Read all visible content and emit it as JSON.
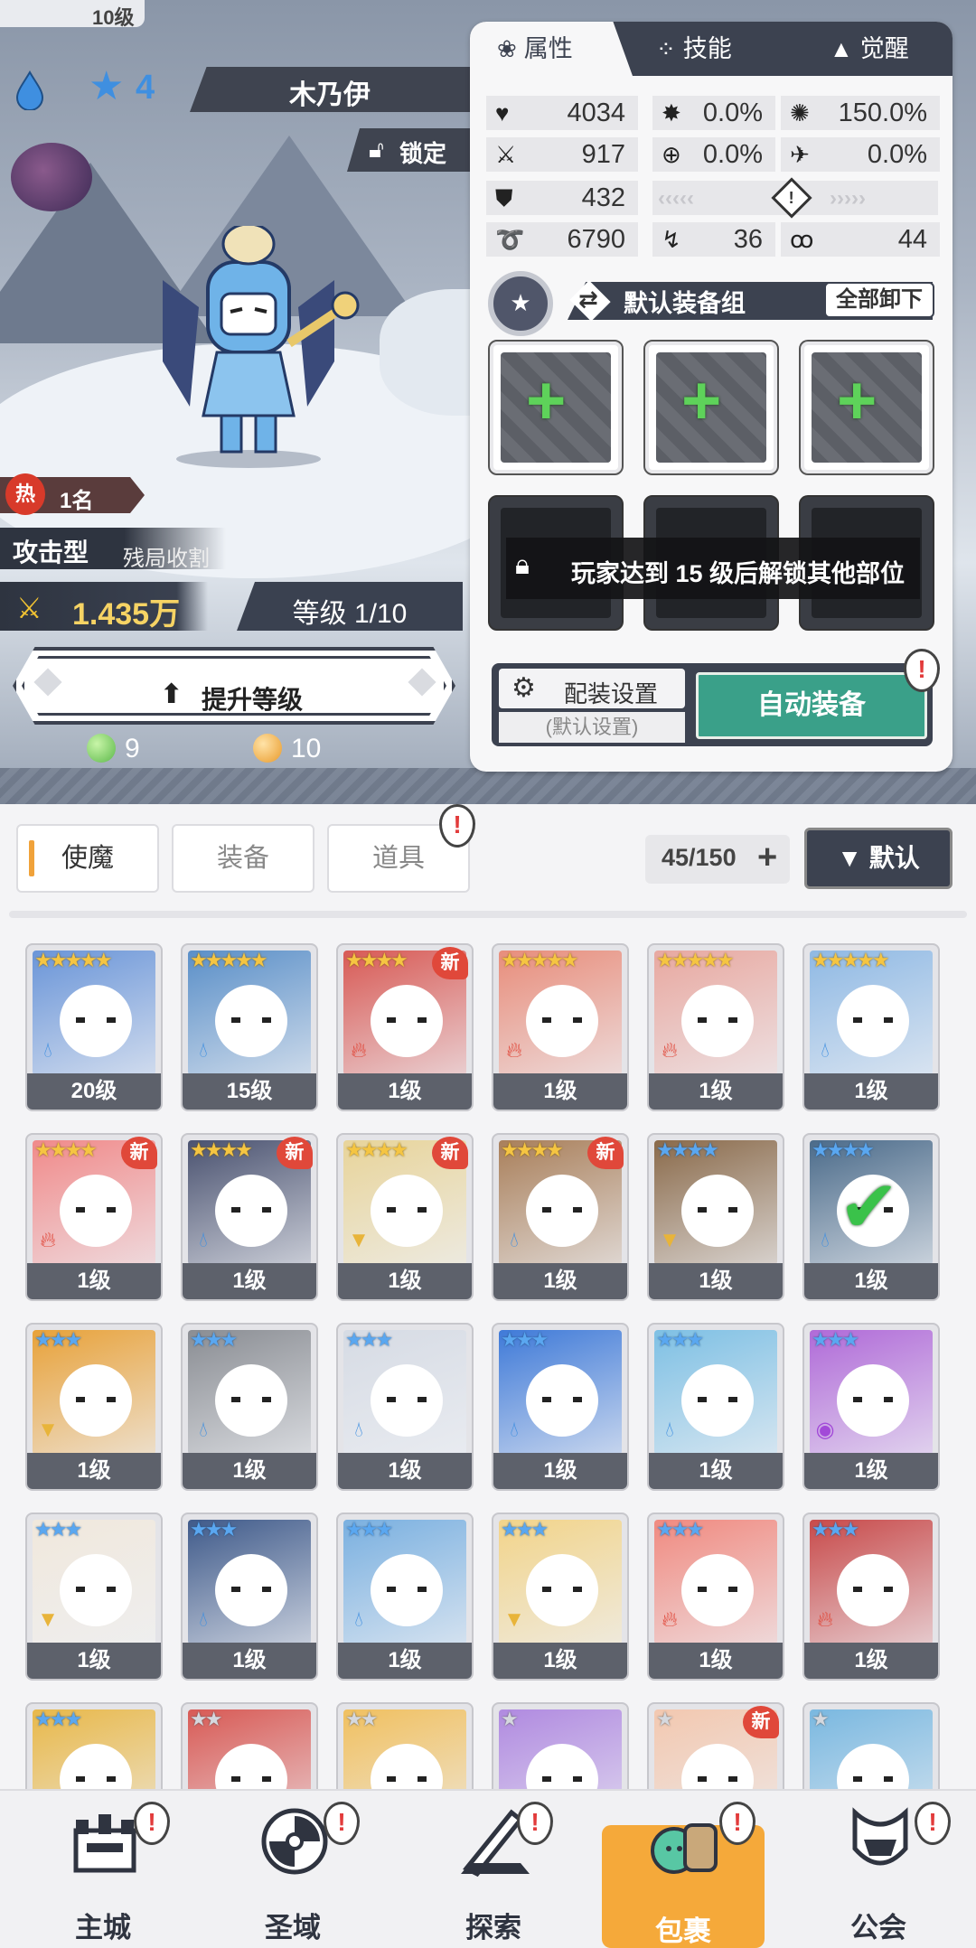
{
  "hero": {
    "level_tag": "10级",
    "star_level": "4",
    "name": "木乃伊",
    "lock_label": "锁定",
    "hot_badge": "热",
    "hot_rank": "1名",
    "type_main": "攻击型",
    "type_sub": "残局收割",
    "power": "1.435万",
    "grade": "等级 1/10",
    "upgrade_label": "提升等级",
    "cost_green": "9",
    "cost_gold": "10"
  },
  "panel": {
    "tabs": [
      {
        "label": "属性",
        "icon": "paw-icon"
      },
      {
        "label": "技能",
        "icon": "sparkle-icon"
      },
      {
        "label": "觉醒",
        "icon": "triangle-icon"
      }
    ],
    "stats": {
      "hp": "4034",
      "crit": "0.0%",
      "crit_damage": "150.0%",
      "attack": "917",
      "accuracy": "0.0%",
      "dodge": "0.0%",
      "defense": "432",
      "speed": "6790",
      "stat_a": "36",
      "stat_b": "44"
    },
    "equip_group_title": "默认装备组",
    "unequip_all": "全部卸下",
    "lock_message": "玩家达到 15 级后解锁其他部位",
    "config_label": "配装设置",
    "config_sub": "(默认设置)",
    "auto_equip": "自动装备",
    "alert_mark": "!"
  },
  "inventory": {
    "tabs": [
      "使魔",
      "装备",
      "道具"
    ],
    "active_tab": "使魔",
    "count": "45/150",
    "sort_label": "▼ 默认",
    "new_label": "新",
    "cards": [
      {
        "level": "20级",
        "stars": "★★★★★",
        "rarity": "gold",
        "elem": "water",
        "color": "#6a95d8",
        "new": false
      },
      {
        "level": "15级",
        "stars": "★★★★★",
        "rarity": "gold",
        "elem": "water",
        "color": "#5a8fc8",
        "new": false
      },
      {
        "level": "1级",
        "stars": "★★★★",
        "rarity": "gold",
        "elem": "fire",
        "color": "#d85a55",
        "new": true
      },
      {
        "level": "1级",
        "stars": "★★★★★",
        "rarity": "gold",
        "elem": "fire",
        "color": "#e88d7b",
        "new": false
      },
      {
        "level": "1级",
        "stars": "★★★★★",
        "rarity": "gold",
        "elem": "fire",
        "color": "#e8a8a0",
        "new": false
      },
      {
        "level": "1级",
        "stars": "★★★★★",
        "rarity": "gold",
        "elem": "water",
        "color": "#8fb9e4",
        "new": false
      },
      {
        "level": "1级",
        "stars": "★★★★",
        "rarity": "gold",
        "elem": "fire",
        "color": "#f08a8a",
        "new": true
      },
      {
        "level": "1级",
        "stars": "★★★★",
        "rarity": "gold",
        "elem": "water",
        "color": "#4a5270",
        "new": true
      },
      {
        "level": "1级",
        "stars": "★★★★",
        "rarity": "gold",
        "elem": "earth",
        "color": "#e8d49a",
        "new": true
      },
      {
        "level": "1级",
        "stars": "★★★★",
        "rarity": "gold",
        "elem": "water",
        "color": "#a97f5a",
        "new": true
      },
      {
        "level": "1级",
        "stars": "★★★★",
        "rarity": "blue",
        "elem": "earth",
        "color": "#8a6a4a",
        "new": false
      },
      {
        "level": "1级",
        "stars": "★★★★",
        "rarity": "blue",
        "elem": "water",
        "color": "#4b6b8a",
        "new": false,
        "check": true
      },
      {
        "level": "1级",
        "stars": "★★★",
        "rarity": "blue",
        "elem": "earth",
        "color": "#e8a23a",
        "new": false
      },
      {
        "level": "1级",
        "stars": "★★★",
        "rarity": "blue",
        "elem": "water",
        "color": "#8a8d93",
        "new": false
      },
      {
        "level": "1级",
        "stars": "★★★",
        "rarity": "blue",
        "elem": "water",
        "color": "#d6dbe4",
        "new": false
      },
      {
        "level": "1级",
        "stars": "★★★",
        "rarity": "blue",
        "elem": "water",
        "color": "#3f7ad8",
        "new": false
      },
      {
        "level": "1级",
        "stars": "★★★",
        "rarity": "blue",
        "elem": "water",
        "color": "#7ec0e4",
        "new": false
      },
      {
        "level": "1级",
        "stars": "★★★",
        "rarity": "blue",
        "elem": "dark",
        "color": "#b06ad8",
        "new": false
      },
      {
        "level": "1级",
        "stars": "★★★",
        "rarity": "blue",
        "elem": "earth",
        "color": "#f0e8dc",
        "new": false
      },
      {
        "level": "1级",
        "stars": "★★★",
        "rarity": "blue",
        "elem": "water",
        "color": "#3f5a8a",
        "new": false
      },
      {
        "level": "1级",
        "stars": "★★★",
        "rarity": "blue",
        "elem": "water",
        "color": "#7ab0e0",
        "new": false
      },
      {
        "level": "1级",
        "stars": "★★★",
        "rarity": "blue",
        "elem": "earth",
        "color": "#f2d48a",
        "new": false
      },
      {
        "level": "1级",
        "stars": "★★★",
        "rarity": "blue",
        "elem": "fire",
        "color": "#f08a80",
        "new": false
      },
      {
        "level": "1级",
        "stars": "★★★",
        "rarity": "blue",
        "elem": "fire",
        "color": "#c84a4a",
        "new": false
      },
      {
        "level": "",
        "stars": "★★★",
        "rarity": "blue",
        "elem": "",
        "color": "#e8b84a",
        "new": false
      },
      {
        "level": "",
        "stars": "★★",
        "rarity": "gray",
        "elem": "",
        "color": "#d85a55",
        "new": false
      },
      {
        "level": "",
        "stars": "★★",
        "rarity": "gray",
        "elem": "",
        "color": "#f0c060",
        "new": false
      },
      {
        "level": "",
        "stars": "★",
        "rarity": "gray",
        "elem": "",
        "color": "#b08ae0",
        "new": false
      },
      {
        "level": "",
        "stars": "★",
        "rarity": "gray",
        "elem": "",
        "color": "#f2c8b0",
        "new": true
      },
      {
        "level": "",
        "stars": "★",
        "rarity": "gray",
        "elem": "",
        "color": "#7ab8e0",
        "new": false
      }
    ]
  },
  "nav": {
    "items": [
      {
        "label": "主城",
        "icon": "castle-icon",
        "active": false
      },
      {
        "label": "圣域",
        "icon": "vortex-icon",
        "active": false
      },
      {
        "label": "探索",
        "icon": "sword-icon",
        "active": false
      },
      {
        "label": "包裹",
        "icon": "bag-icon",
        "active": true
      },
      {
        "label": "公会",
        "icon": "guild-icon",
        "active": false
      }
    ]
  },
  "colors": {
    "accent_dark": "#3c4250",
    "auto_green": "#3aa089",
    "nav_active": "#f5a93a",
    "alert_red": "#e23b3b"
  }
}
